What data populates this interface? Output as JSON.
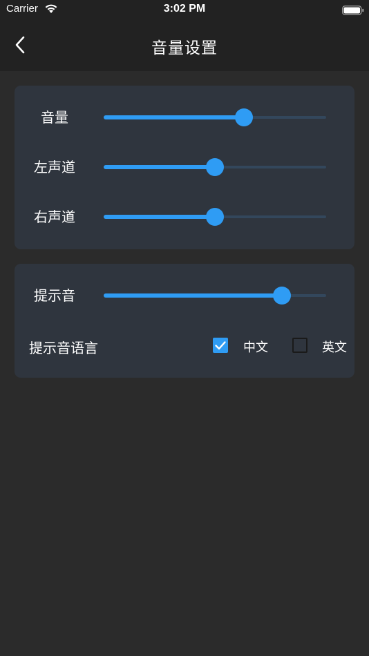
{
  "status_bar": {
    "carrier": "Carrier",
    "time": "3:02 PM"
  },
  "nav": {
    "title": "音量设置",
    "back_icon": "chevron-left-icon"
  },
  "volume_card": {
    "rows": [
      {
        "label": "音量",
        "value": 0.63
      },
      {
        "label": "左声道",
        "value": 0.5
      },
      {
        "label": "右声道",
        "value": 0.5
      }
    ]
  },
  "prompt_card": {
    "prompt_tone": {
      "label": "提示音",
      "value": 0.8
    },
    "language": {
      "label": "提示音语言",
      "options": [
        {
          "label": "中文",
          "checked": true
        },
        {
          "label": "英文",
          "checked": false
        }
      ]
    }
  },
  "colors": {
    "accent": "#2f9cf4",
    "background": "#2b2b2b",
    "nav_background": "#222222",
    "card_background": "#2f353e",
    "track_background": "#33475c"
  }
}
